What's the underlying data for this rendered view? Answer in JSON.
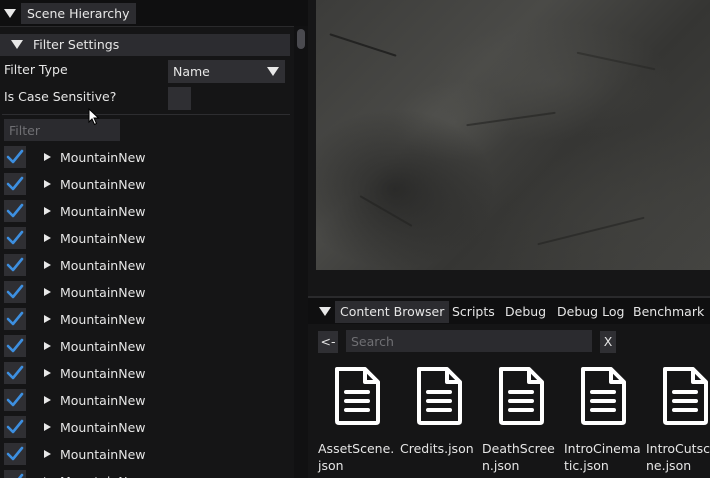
{
  "left_panel": {
    "tab_label": "Scene Hierarchy",
    "filter_settings": {
      "header": "Filter Settings",
      "filter_type_label": "Filter Type",
      "filter_type_value": "Name",
      "case_sensitive_label": "Is Case Sensitive?",
      "case_sensitive_checked": false,
      "filter_placeholder": "Filter",
      "filter_value": ""
    },
    "items": [
      {
        "label": "MountainNew",
        "checked": true
      },
      {
        "label": "MountainNew",
        "checked": true
      },
      {
        "label": "MountainNew",
        "checked": true
      },
      {
        "label": "MountainNew",
        "checked": true
      },
      {
        "label": "MountainNew",
        "checked": true
      },
      {
        "label": "MountainNew",
        "checked": true
      },
      {
        "label": "MountainNew",
        "checked": true
      },
      {
        "label": "MountainNew",
        "checked": true
      },
      {
        "label": "MountainNew",
        "checked": true
      },
      {
        "label": "MountainNew",
        "checked": true
      },
      {
        "label": "MountainNew",
        "checked": true
      },
      {
        "label": "MountainNew",
        "checked": true
      },
      {
        "label": "MountainNew",
        "checked": true
      }
    ]
  },
  "bottom_panel": {
    "tabs": [
      {
        "label": "Content Browser",
        "active": true
      },
      {
        "label": "Scripts",
        "active": false
      },
      {
        "label": "Debug",
        "active": false
      },
      {
        "label": "Debug Log",
        "active": false
      },
      {
        "label": "Benchmark",
        "active": false
      }
    ],
    "back_label": "<-",
    "search_placeholder": "Search",
    "search_value": "",
    "clear_label": "X",
    "files": [
      {
        "name": "AssetScene.json",
        "icon": "file-icon"
      },
      {
        "name": "Credits.json",
        "icon": "file-icon"
      },
      {
        "name": "DeathScreen.json",
        "icon": "file-icon"
      },
      {
        "name": "IntroCinematic.json",
        "icon": "file-icon"
      },
      {
        "name": "IntroCutscene.json",
        "icon": "file-icon"
      }
    ]
  },
  "colors": {
    "checkbox_check": "#3d8fe0",
    "panel_bg": "#151516",
    "title_bg": "#0f0f10",
    "widget_bg": "#2f2f33"
  }
}
